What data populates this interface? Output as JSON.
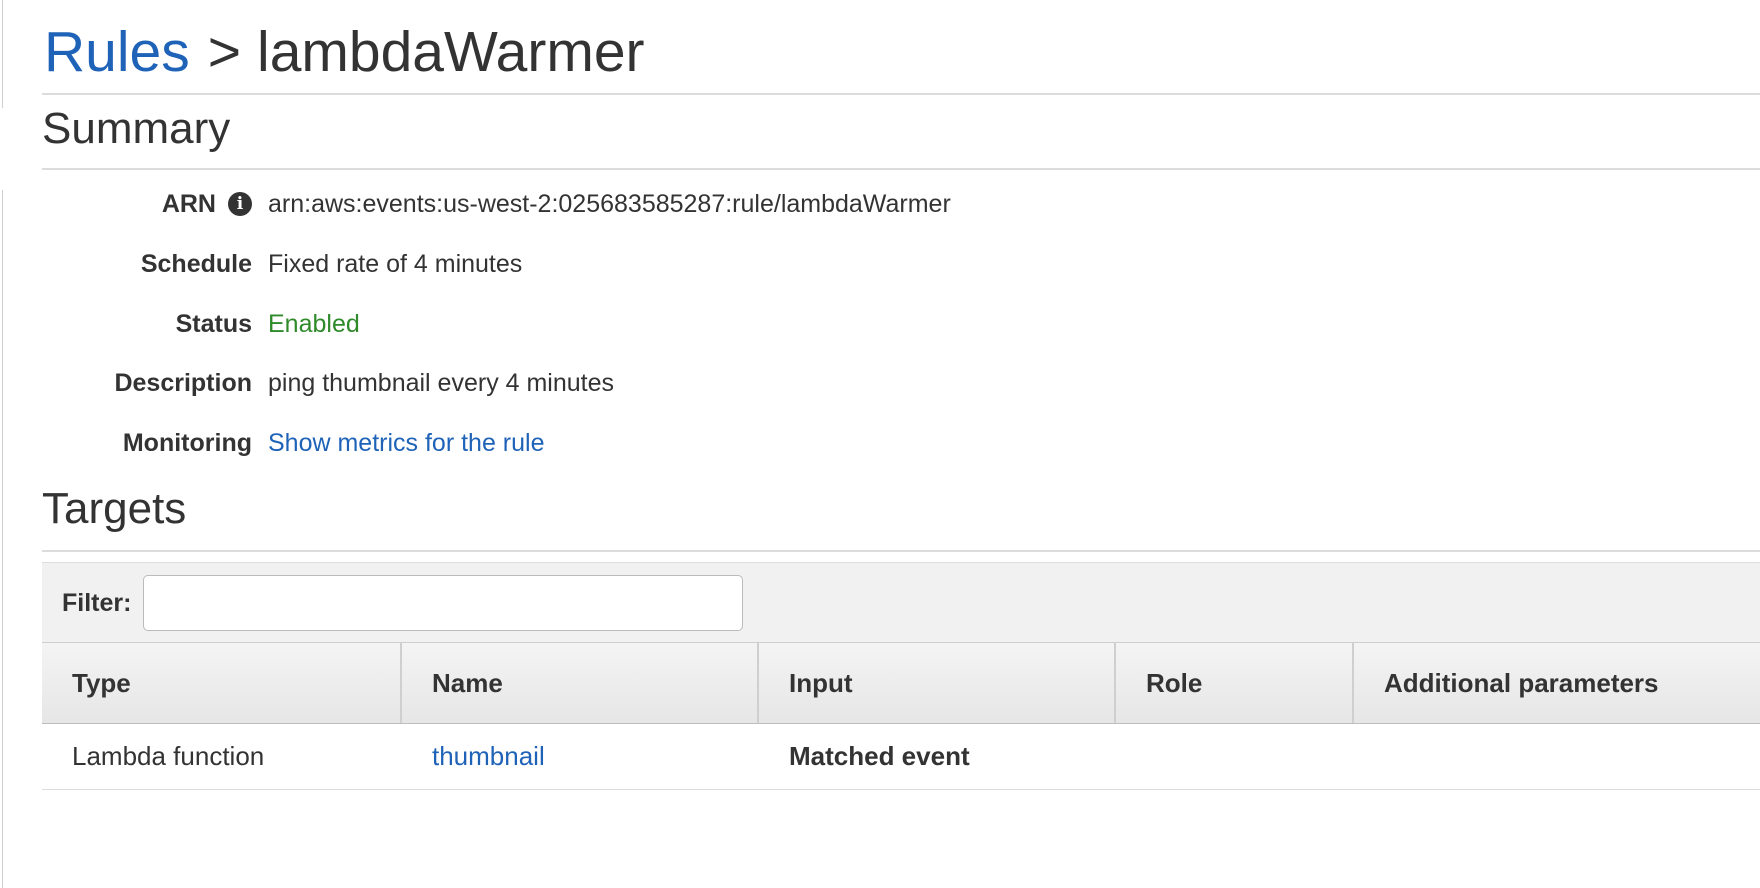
{
  "breadcrumb": {
    "parent_label": "Rules",
    "separator": ">",
    "current": "lambdaWarmer"
  },
  "summary": {
    "title": "Summary",
    "fields": {
      "arn": {
        "label": "ARN",
        "value": "arn:aws:events:us-west-2:025683585287:rule/lambdaWarmer",
        "icon": "info-icon"
      },
      "schedule": {
        "label": "Schedule",
        "value": "Fixed rate of 4 minutes"
      },
      "status": {
        "label": "Status",
        "value": "Enabled"
      },
      "description": {
        "label": "Description",
        "value": "ping thumbnail every 4 minutes"
      },
      "monitoring": {
        "label": "Monitoring",
        "value": "Show metrics for the rule"
      }
    }
  },
  "targets": {
    "title": "Targets",
    "filter": {
      "label": "Filter:",
      "value": "",
      "placeholder": ""
    },
    "columns": [
      "Type",
      "Name",
      "Input",
      "Role",
      "Additional parameters"
    ],
    "rows": [
      {
        "type": "Lambda function",
        "name": "thumbnail",
        "input": "Matched event",
        "role": "",
        "additional": ""
      }
    ]
  },
  "colors": {
    "link": "#1f63b8",
    "enabled_status": "#2f8a2a",
    "text": "#333333",
    "header_bg": "#e6e6e6"
  }
}
